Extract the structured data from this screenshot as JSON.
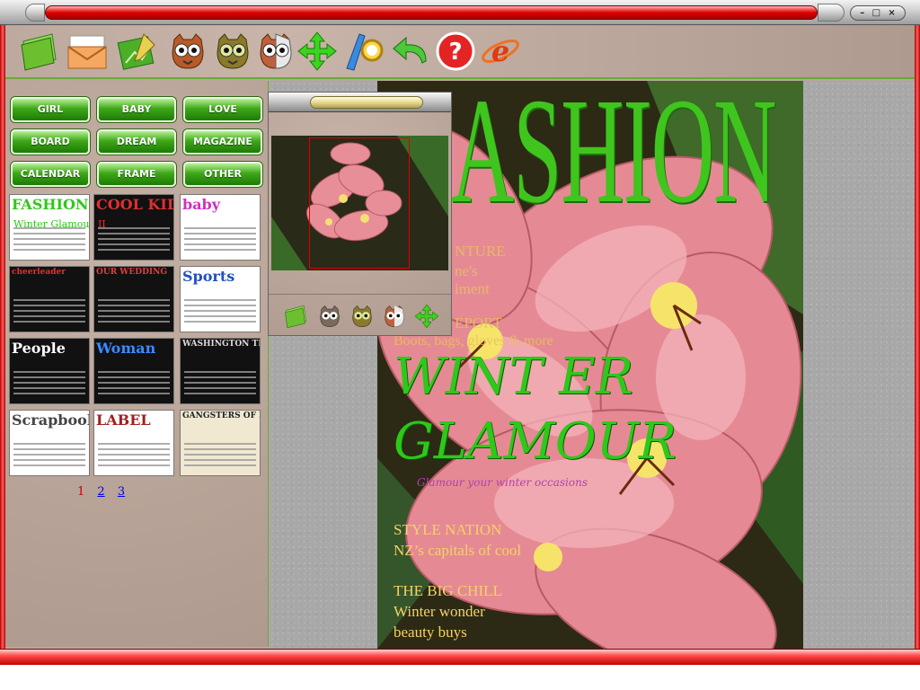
{
  "window": {
    "controls": [
      "–",
      "□",
      "×"
    ],
    "accent_red": "#e00000"
  },
  "toolbar": {
    "buttons": [
      {
        "name": "open-folder-icon",
        "color": "#7ac943"
      },
      {
        "name": "envelope-icon",
        "color": "#f0a050"
      },
      {
        "name": "edit-image-icon",
        "color": "#4caf2a"
      },
      {
        "name": "owl-face-icon",
        "color": "#b05a2a"
      },
      {
        "name": "owl-face-green-icon",
        "color": "#6a8a2a"
      },
      {
        "name": "owl-face-half-icon",
        "color": "#c0603a"
      },
      {
        "name": "move-arrows-icon",
        "color": "#2ec81a"
      },
      {
        "name": "crop-zoom-icon",
        "color": "#3a8ae0"
      },
      {
        "name": "undo-icon",
        "color": "#3aa83a"
      },
      {
        "name": "help-icon",
        "color": "#e02020"
      },
      {
        "name": "internet-explorer-icon",
        "color": "#e05010"
      }
    ]
  },
  "categories": [
    "GIRL",
    "BABY",
    "LOVE",
    "BOARD",
    "DREAM",
    "MAGAZINE",
    "CALENDAR",
    "FRAME",
    "OTHER"
  ],
  "templates": [
    {
      "title": "FASHION",
      "sub": "Winter Glamour",
      "bg": "#ffffff",
      "fg": "#2ec81a"
    },
    {
      "title": "COOL KID",
      "sub": "II",
      "bg": "#111111",
      "fg": "#e03030"
    },
    {
      "title": "baby",
      "sub": "",
      "bg": "#ffffff",
      "fg": "#d030c0"
    },
    {
      "title": "cheerleader",
      "sub": "",
      "bg": "#111111",
      "fg": "#e03030"
    },
    {
      "title": "OUR WEDDING",
      "sub": "",
      "bg": "#111111",
      "fg": "#e04040"
    },
    {
      "title": "Sports",
      "sub": "",
      "bg": "#ffffff",
      "fg": "#2050c0"
    },
    {
      "title": "People",
      "sub": "",
      "bg": "#111111",
      "fg": "#ffffff"
    },
    {
      "title": "Woman",
      "sub": "",
      "bg": "#111111",
      "fg": "#3a8aff"
    },
    {
      "title": "WASHINGTON TRAILS",
      "sub": "",
      "bg": "#111111",
      "fg": "#dddddd"
    },
    {
      "title": "Scrapbook",
      "sub": "",
      "bg": "#ffffff",
      "fg": "#444444"
    },
    {
      "title": "LABEL",
      "sub": "",
      "bg": "#ffffff",
      "fg": "#a02020"
    },
    {
      "title": "GANGSTERS OF LIBERTY",
      "sub": "",
      "bg": "#f0e8d0",
      "fg": "#222222"
    }
  ],
  "pager": {
    "current": "1",
    "pages": [
      "2",
      "3"
    ]
  },
  "cover": {
    "title": "ASHION",
    "lines": [
      {
        "text": "NTURE",
        "dim": true
      },
      {
        "text": "ne's",
        "dim": true
      },
      {
        "text": "iment",
        "dim": true
      },
      {
        "text": "EPORT",
        "dim": true
      },
      {
        "text": "Boots, bags, gloves & more",
        "dim": true
      }
    ],
    "winter": "WINT ER",
    "glamour": "GLAMOUR",
    "tagline": "Glamour your winter occasions",
    "style_head": "STYLE NATION",
    "style_sub": "NZ’s capitals of cool",
    "chill_head": "THE BIG CHILL",
    "chill_sub1": "Winter wonder",
    "chill_sub2": "beauty buys"
  },
  "navigator": {
    "tools": [
      "open-folder-icon",
      "owl-face-icon",
      "owl-face-green-icon",
      "owl-face-half-icon",
      "move-arrows-icon"
    ]
  }
}
